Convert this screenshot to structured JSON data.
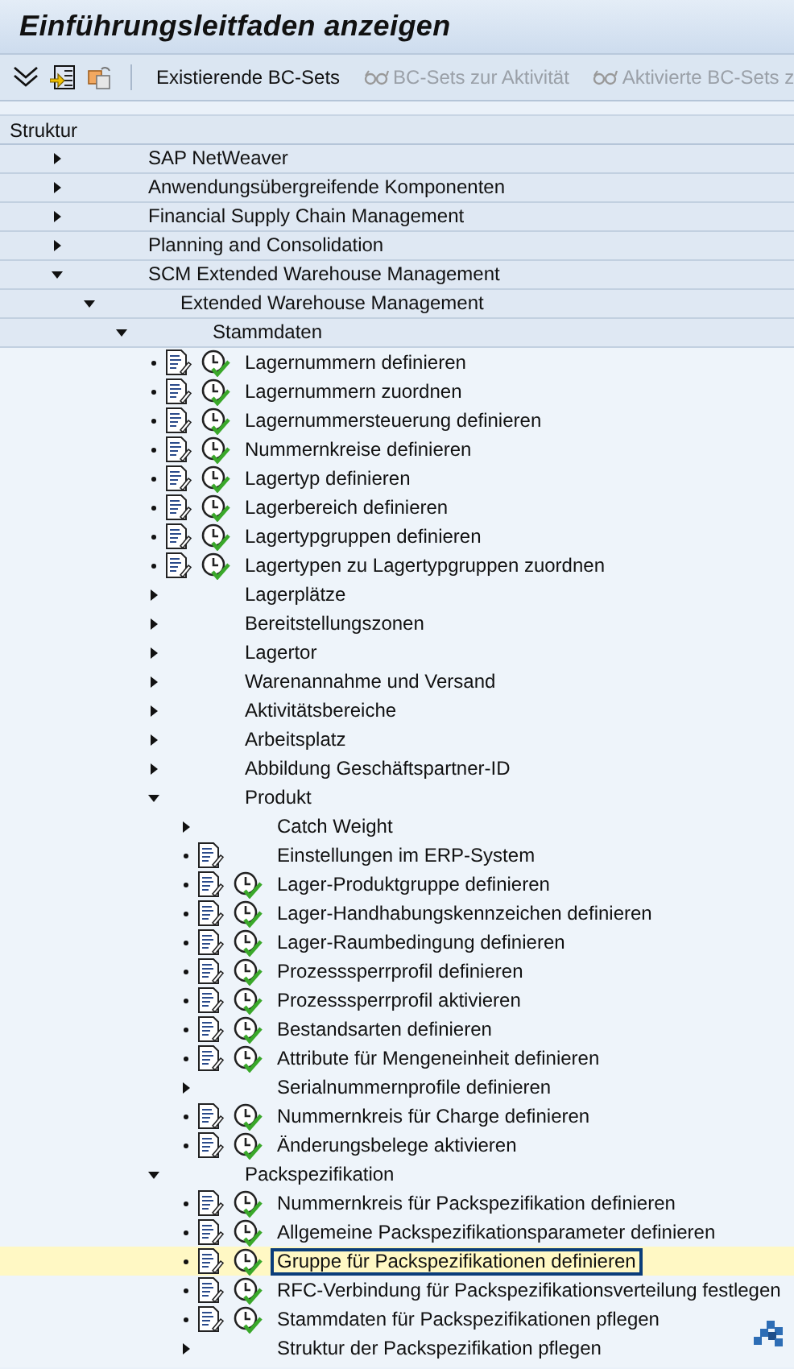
{
  "window": {
    "title": "Einführungsleitfaden anzeigen"
  },
  "toolbar": [
    {
      "kind": "icon"
    },
    {
      "kind": "icon"
    },
    {
      "kind": "icon"
    },
    {
      "kind": "separator"
    },
    {
      "kind": "button",
      "label": "Existierende BC-Sets",
      "disabled": false
    },
    {
      "kind": "glasses-button",
      "label": "BC-Sets zur Aktivität",
      "disabled": true
    },
    {
      "kind": "glasses-button",
      "label": "Aktivierte BC-Sets z",
      "disabled": true
    }
  ],
  "header": "Struktur",
  "tree": [
    {
      "label": "SAP NetWeaver",
      "kind": "folder",
      "expanded": false,
      "selected": false
    },
    {
      "label": "Anwendungsübergreifende Komponenten",
      "kind": "folder",
      "expanded": false,
      "selected": false
    },
    {
      "label": "Financial Supply Chain Management",
      "kind": "folder",
      "expanded": false,
      "selected": false
    },
    {
      "label": "Planning and Consolidation",
      "kind": "folder",
      "expanded": false,
      "selected": false
    },
    {
      "label": "SCM Extended Warehouse Management",
      "kind": "folder",
      "expanded": true,
      "selected": false,
      "children": [
        {
          "label": "Extended Warehouse Management",
          "kind": "folder",
          "expanded": true,
          "selected": false,
          "children": [
            {
              "label": "Stammdaten",
              "kind": "folder",
              "expanded": true,
              "selected": false,
              "children": [
                {
                  "label": "Lagernummern definieren",
                  "kind": "activity",
                  "clock": true,
                  "selected": false
                },
                {
                  "label": "Lagernummern zuordnen",
                  "kind": "activity",
                  "clock": true,
                  "selected": false
                },
                {
                  "label": "Lagernummersteuerung definieren",
                  "kind": "activity",
                  "clock": true,
                  "selected": false
                },
                {
                  "label": "Nummernkreise definieren",
                  "kind": "activity",
                  "clock": true,
                  "selected": false
                },
                {
                  "label": "Lagertyp definieren",
                  "kind": "activity",
                  "clock": true,
                  "selected": false
                },
                {
                  "label": "Lagerbereich definieren",
                  "kind": "activity",
                  "clock": true,
                  "selected": false
                },
                {
                  "label": "Lagertypgruppen definieren",
                  "kind": "activity",
                  "clock": true,
                  "selected": false
                },
                {
                  "label": "Lagertypen zu Lagertypgruppen zuordnen",
                  "kind": "activity",
                  "clock": true,
                  "selected": false
                },
                {
                  "label": "Lagerplätze",
                  "kind": "folder",
                  "expanded": false,
                  "selected": false
                },
                {
                  "label": "Bereitstellungszonen",
                  "kind": "folder",
                  "expanded": false,
                  "selected": false
                },
                {
                  "label": "Lagertor",
                  "kind": "folder",
                  "expanded": false,
                  "selected": false
                },
                {
                  "label": "Warenannahme und Versand",
                  "kind": "folder",
                  "expanded": false,
                  "selected": false
                },
                {
                  "label": "Aktivitätsbereiche",
                  "kind": "folder",
                  "expanded": false,
                  "selected": false
                },
                {
                  "label": "Arbeitsplatz",
                  "kind": "folder",
                  "expanded": false,
                  "selected": false
                },
                {
                  "label": "Abbildung Geschäftspartner-ID",
                  "kind": "folder",
                  "expanded": false,
                  "selected": false
                },
                {
                  "label": "Produkt",
                  "kind": "folder",
                  "expanded": true,
                  "selected": false,
                  "children": [
                    {
                      "label": "Catch Weight",
                      "kind": "folder",
                      "expanded": false,
                      "selected": false
                    },
                    {
                      "label": "Einstellungen im ERP-System",
                      "kind": "activity",
                      "clock": false,
                      "selected": false
                    },
                    {
                      "label": "Lager-Produktgruppe definieren",
                      "kind": "activity",
                      "clock": true,
                      "selected": false
                    },
                    {
                      "label": "Lager-Handhabungskennzeichen definieren",
                      "kind": "activity",
                      "clock": true,
                      "selected": false
                    },
                    {
                      "label": "Lager-Raumbedingung definieren",
                      "kind": "activity",
                      "clock": true,
                      "selected": false
                    },
                    {
                      "label": "Prozesssperrprofil definieren",
                      "kind": "activity",
                      "clock": true,
                      "selected": false
                    },
                    {
                      "label": "Prozesssperrprofil aktivieren",
                      "kind": "activity",
                      "clock": true,
                      "selected": false
                    },
                    {
                      "label": "Bestandsarten definieren",
                      "kind": "activity",
                      "clock": true,
                      "selected": false
                    },
                    {
                      "label": "Attribute für Mengeneinheit definieren",
                      "kind": "activity",
                      "clock": true,
                      "selected": false
                    },
                    {
                      "label": "Serialnummernprofile definieren",
                      "kind": "folder",
                      "expanded": false,
                      "selected": false
                    },
                    {
                      "label": "Nummernkreis für Charge definieren",
                      "kind": "activity",
                      "clock": true,
                      "selected": false
                    },
                    {
                      "label": "Änderungsbelege aktivieren",
                      "kind": "activity",
                      "clock": true,
                      "selected": false
                    }
                  ]
                },
                {
                  "label": "Packspezifikation",
                  "kind": "folder",
                  "expanded": true,
                  "selected": false,
                  "children": [
                    {
                      "label": "Nummernkreis für Packspezifikation definieren",
                      "kind": "activity",
                      "clock": true,
                      "selected": false
                    },
                    {
                      "label": "Allgemeine Packspezifikationsparameter definieren",
                      "kind": "activity",
                      "clock": true,
                      "selected": false
                    },
                    {
                      "label": "Gruppe für Packspezifikationen definieren",
                      "kind": "activity",
                      "clock": true,
                      "selected": true
                    },
                    {
                      "label": "RFC-Verbindung für Packspezifikationsverteilung festlegen",
                      "kind": "activity",
                      "clock": true,
                      "selected": false
                    },
                    {
                      "label": "Stammdaten für Packspezifikationen pflegen",
                      "kind": "activity",
                      "clock": true,
                      "selected": false
                    },
                    {
                      "label": "Struktur der Packspezifikation pflegen",
                      "kind": "folder",
                      "expanded": false,
                      "selected": false
                    }
                  ]
                }
              ]
            }
          ]
        }
      ]
    }
  ]
}
